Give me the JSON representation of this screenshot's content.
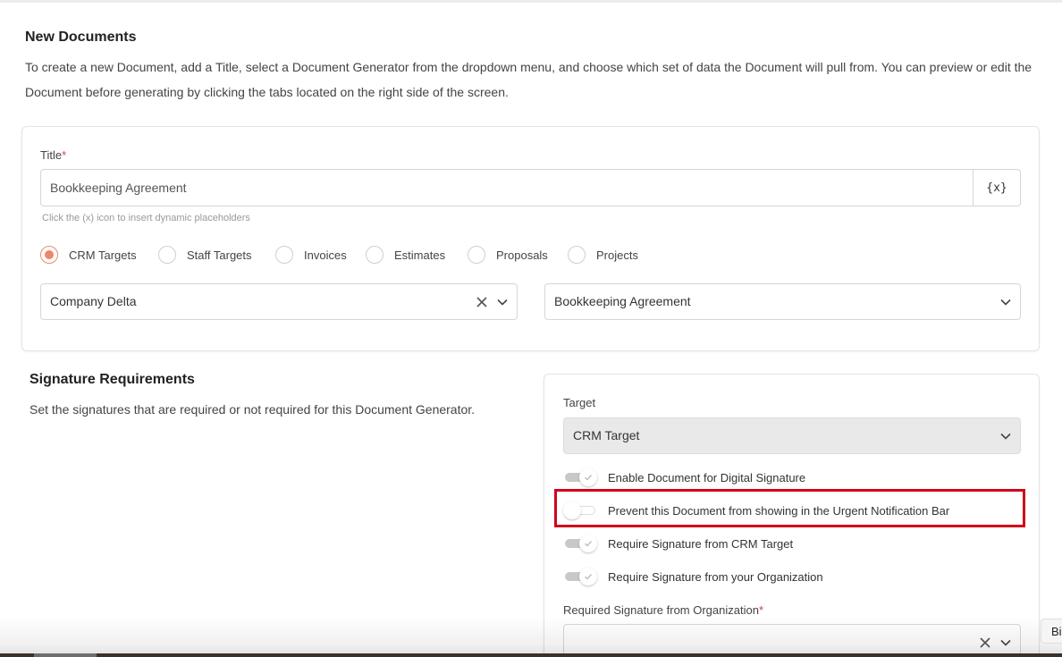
{
  "page": {
    "heading": "New Documents",
    "intro": "To create a new Document, add a Title, select a Document Generator from the dropdown menu, and choose which set of data the Document will pull from. You can preview or edit the Document before generating by clicking the tabs located on the right side of the screen."
  },
  "form": {
    "title_label": "Title",
    "required_mark": "*",
    "title_value": "Bookkeeping Agreement",
    "placeholder_button": "{x}",
    "hint": "Click the (x) icon to insert dynamic placeholders",
    "radios": [
      {
        "label": "CRM Targets",
        "checked": true
      },
      {
        "label": "Staff Targets",
        "checked": false
      },
      {
        "label": "Invoices",
        "checked": false
      },
      {
        "label": "Estimates",
        "checked": false
      },
      {
        "label": "Proposals",
        "checked": false
      },
      {
        "label": "Projects",
        "checked": false
      }
    ],
    "target_select_value": "Company Delta",
    "generator_select_value": "Bookkeeping Agreement"
  },
  "signature": {
    "heading": "Signature Requirements",
    "description": "Set the signatures that are required or not required for this Document Generator.",
    "target_label": "Target",
    "target_value": "CRM Target",
    "toggles": [
      {
        "label": "Enable Document for Digital Signature",
        "on": true
      },
      {
        "label": "Prevent this Document from showing in the Urgent Notification Bar",
        "on": false
      },
      {
        "label": "Require Signature from CRM Target",
        "on": true
      },
      {
        "label": "Require Signature from your Organization",
        "on": true
      }
    ],
    "org_label": "Required Signature from Organization",
    "org_value": ""
  },
  "corner_tab": "Bi",
  "colors": {
    "accent": "#f1846a",
    "highlight": "#d0021b",
    "required": "#e0393e"
  }
}
